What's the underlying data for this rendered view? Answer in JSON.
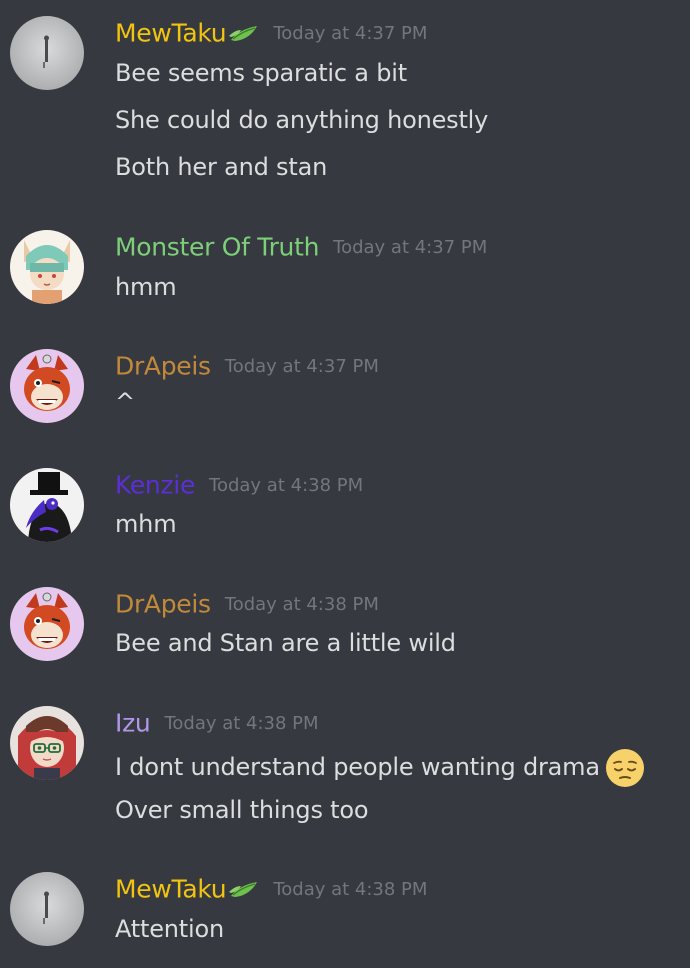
{
  "colors": {
    "background": "#36393f",
    "message_text": "#dcddde",
    "timestamp": "#72767d",
    "mewtaku": "#f1c40f",
    "monster_of_truth": "#7dcf7a",
    "drapeis": "#c2893b",
    "kenzie": "#5b2fd4",
    "izu": "#b296e8"
  },
  "messages": [
    {
      "author": "MewTaku",
      "author_badge_icon": "leaf-badge-icon",
      "timestamp": "Today at 4:37 PM",
      "lines": [
        "Bee seems sparatic a bit",
        "She could do anything honestly",
        "Both her and stan"
      ]
    },
    {
      "author": "Monster Of Truth",
      "timestamp": "Today at 4:37 PM",
      "lines": [
        "hmm"
      ]
    },
    {
      "author": "DrApeis",
      "timestamp": "Today at 4:37 PM",
      "lines": [
        "^"
      ]
    },
    {
      "author": "Kenzie",
      "timestamp": "Today at 4:38 PM",
      "lines": [
        "mhm"
      ]
    },
    {
      "author": "DrApeis",
      "timestamp": "Today at 4:38 PM",
      "lines": [
        "Bee and Stan are a little wild"
      ]
    },
    {
      "author": "Izu",
      "timestamp": "Today at 4:38 PM",
      "lines": [
        "I dont understand people wanting drama",
        "Over small things too"
      ],
      "line_emoji": "pensive-face-emoji"
    },
    {
      "author": "MewTaku",
      "author_badge_icon": "leaf-badge-icon",
      "timestamp": "Today at 4:38 PM",
      "lines": [
        "Attention"
      ]
    }
  ]
}
